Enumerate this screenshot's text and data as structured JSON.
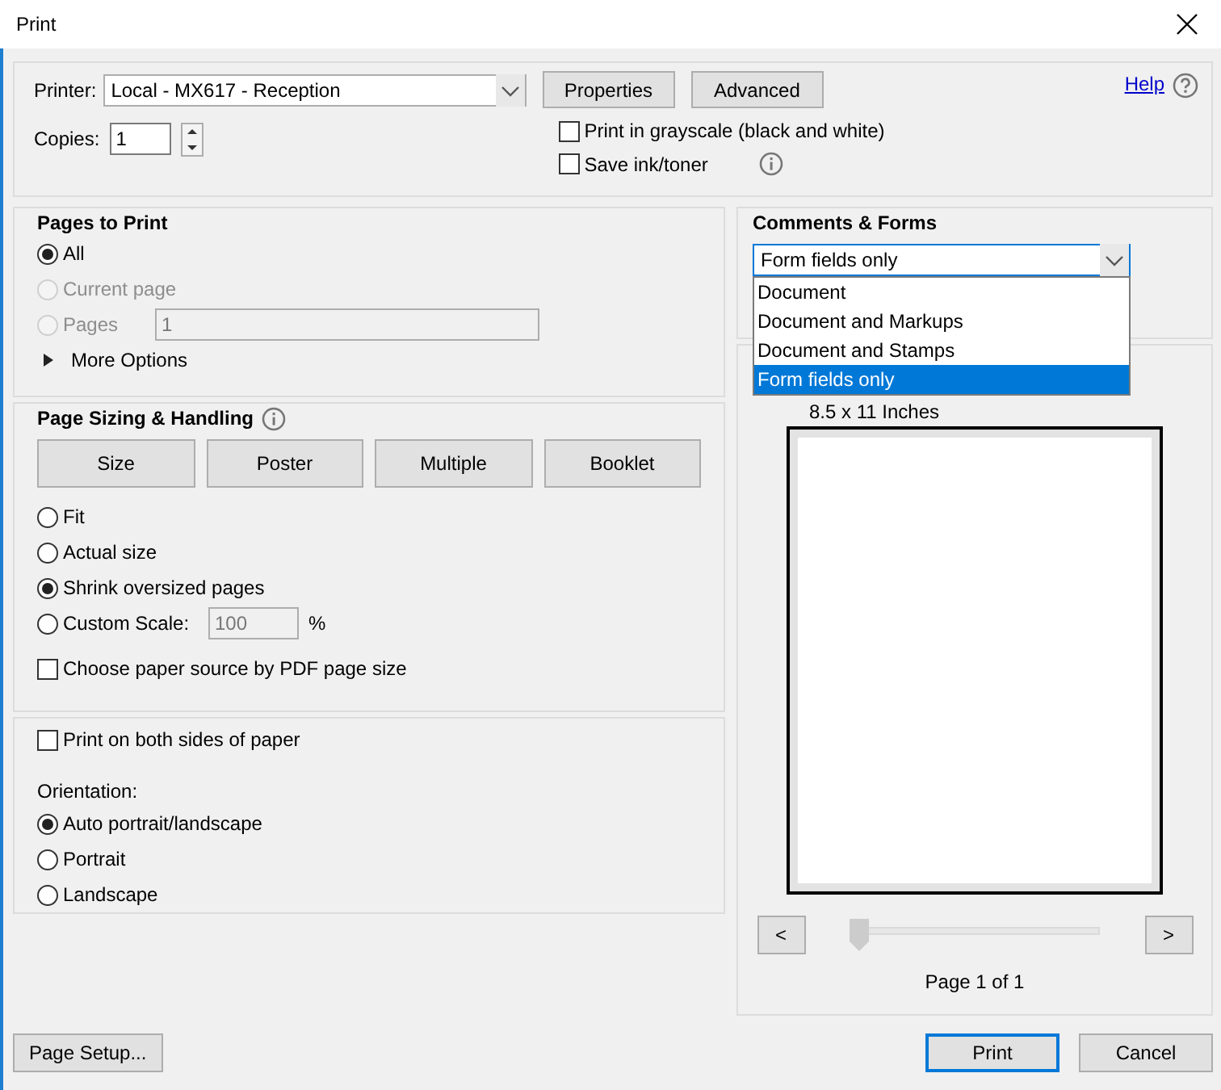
{
  "window": {
    "title": "Print"
  },
  "printer": {
    "label": "Printer:",
    "value": "Local - MX617 - Reception"
  },
  "top_buttons": [
    "Properties",
    "Advanced"
  ],
  "help": "Help",
  "copies": {
    "label": "Copies:",
    "value": "1"
  },
  "print_options": [
    {
      "label": "Print in grayscale (black and white)",
      "checked": false,
      "info": false
    },
    {
      "label": "Save ink/toner",
      "checked": false,
      "info": true
    }
  ],
  "pages_to_print": {
    "title": "Pages to Print",
    "options": [
      {
        "label": "All",
        "selected": true,
        "disabled": false
      },
      {
        "label": "Current page",
        "selected": false,
        "disabled": true
      },
      {
        "label": "Pages",
        "selected": false,
        "disabled": true,
        "value": "1"
      }
    ],
    "more_options": {
      "label": "More Options",
      "expanded": false
    }
  },
  "page_sizing": {
    "title": "Page Sizing & Handling",
    "modes": [
      "Size",
      "Poster",
      "Multiple",
      "Booklet"
    ],
    "scale_options": [
      {
        "label": "Fit",
        "selected": false
      },
      {
        "label": "Actual size",
        "selected": false
      },
      {
        "label": "Shrink oversized pages",
        "selected": true
      },
      {
        "label": "Custom Scale:",
        "selected": false,
        "value": "100",
        "unit": "%"
      }
    ],
    "paper_source": {
      "label": "Choose paper source by PDF page size",
      "checked": false
    }
  },
  "duplex": {
    "label": "Print on both sides of paper",
    "checked": false
  },
  "orientation": {
    "label": "Orientation:",
    "options": [
      {
        "label": "Auto portrait/landscape",
        "selected": true
      },
      {
        "label": "Portrait",
        "selected": false
      },
      {
        "label": "Landscape",
        "selected": false
      }
    ]
  },
  "comments_forms": {
    "title": "Comments & Forms",
    "value": "Form fields only",
    "expanded": true,
    "options": [
      {
        "label": "Document",
        "selected": false
      },
      {
        "label": "Document and Markups",
        "selected": false
      },
      {
        "label": "Document and Stamps",
        "selected": false
      },
      {
        "label": "Form fields only",
        "selected": true
      }
    ]
  },
  "preview": {
    "paper_size": "8.5 x 11 Inches",
    "prev": "<",
    "next": ">",
    "level": 0,
    "page_label": "Page 1 of 1"
  },
  "bottom_buttons": {
    "page_setup": "Page Setup...",
    "print": "Print",
    "cancel": "Cancel"
  }
}
